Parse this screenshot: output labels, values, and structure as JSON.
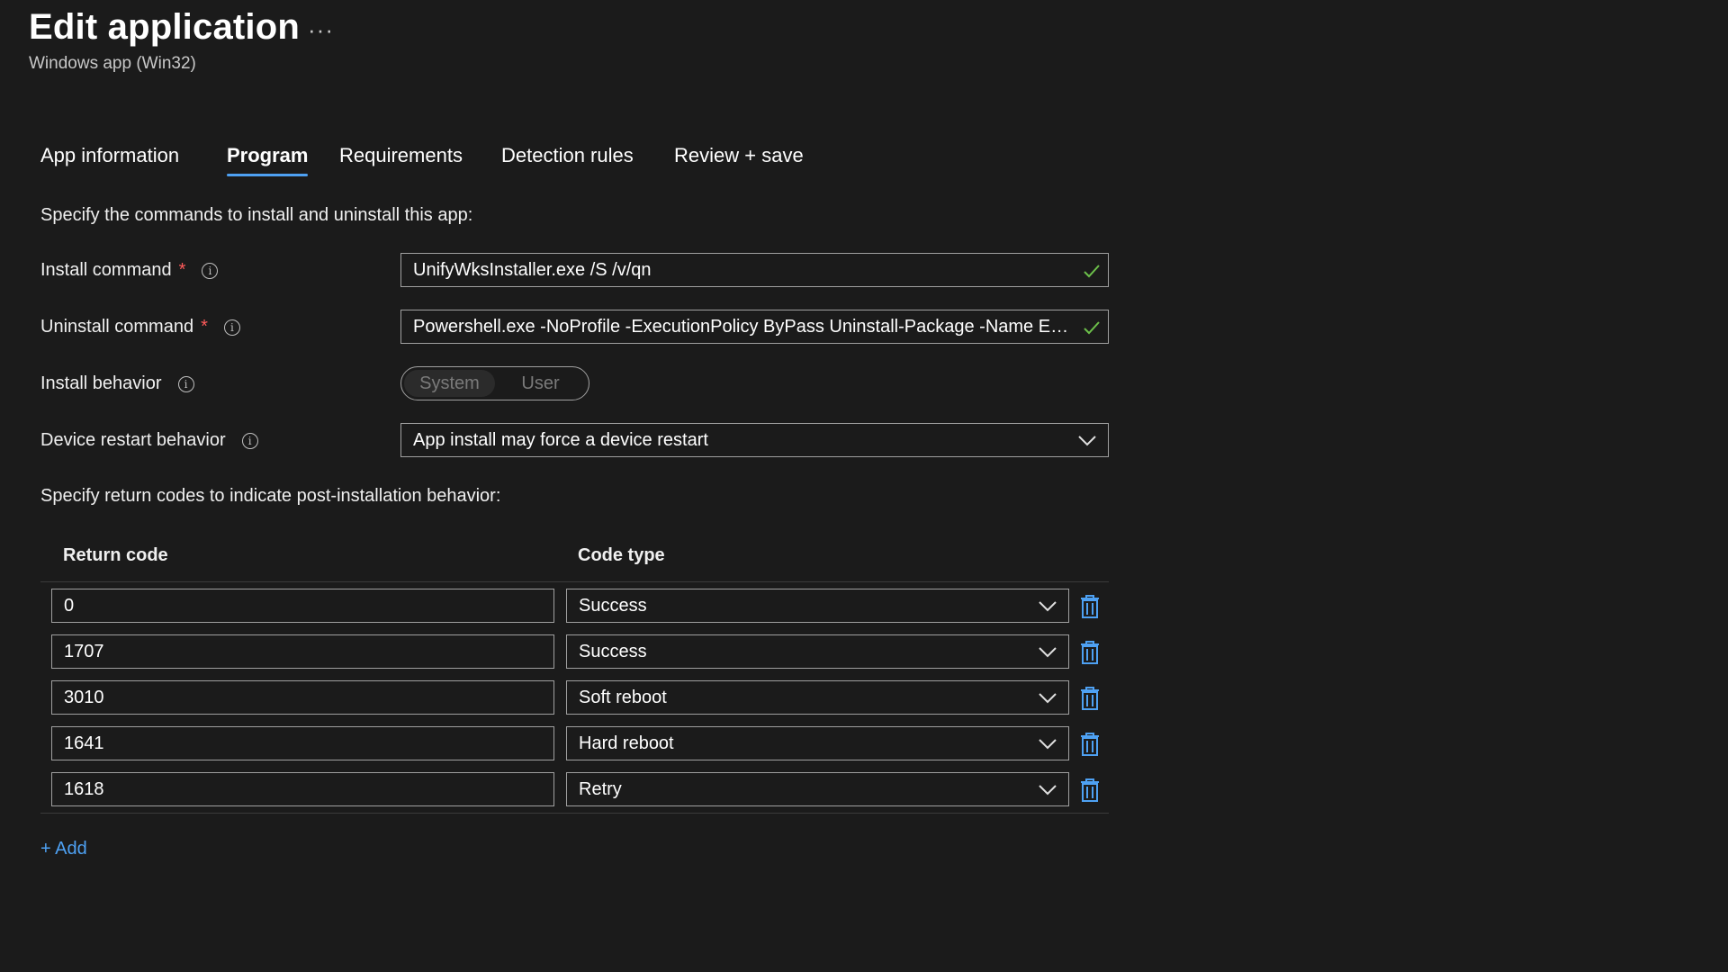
{
  "header": {
    "title": "Edit application",
    "more_label": "···",
    "subtitle": "Windows app (Win32)"
  },
  "tabs": [
    {
      "label": "App information",
      "active": false
    },
    {
      "label": "Program",
      "active": true
    },
    {
      "label": "Requirements",
      "active": false
    },
    {
      "label": "Detection rules",
      "active": false
    },
    {
      "label": "Review + save",
      "active": false
    }
  ],
  "program": {
    "intro": "Specify the commands to install and uninstall this app:",
    "install_command": {
      "label": "Install command",
      "required_mark": "*",
      "value": "UnifyWksInstaller.exe /S /v/qn"
    },
    "uninstall_command": {
      "label": "Uninstall command",
      "required_mark": "*",
      "value": "Powershell.exe -NoProfile -ExecutionPolicy ByPass Uninstall-Package -Name ET..."
    },
    "install_behavior": {
      "label": "Install behavior",
      "options": [
        "System",
        "User"
      ],
      "selected": "System"
    },
    "device_restart": {
      "label": "Device restart behavior",
      "value": "App install may force a device restart"
    },
    "return_codes_intro": "Specify return codes to indicate post-installation behavior:",
    "table": {
      "col_return_code": "Return code",
      "col_code_type": "Code type",
      "rows": [
        {
          "code": "0",
          "type": "Success"
        },
        {
          "code": "1707",
          "type": "Success"
        },
        {
          "code": "3010",
          "type": "Soft reboot"
        },
        {
          "code": "1641",
          "type": "Hard reboot"
        },
        {
          "code": "1618",
          "type": "Retry"
        }
      ]
    },
    "add_label": "+ Add"
  },
  "colors": {
    "background": "#1b1b1b",
    "accent": "#4ea1f3",
    "required": "#ff5a5a",
    "valid_check": "#6cc04a"
  },
  "icons": {
    "more": "ellipsis-icon",
    "info": "info-icon",
    "valid": "checkmark-icon",
    "dropdown": "chevron-down-icon",
    "delete": "trash-icon"
  }
}
